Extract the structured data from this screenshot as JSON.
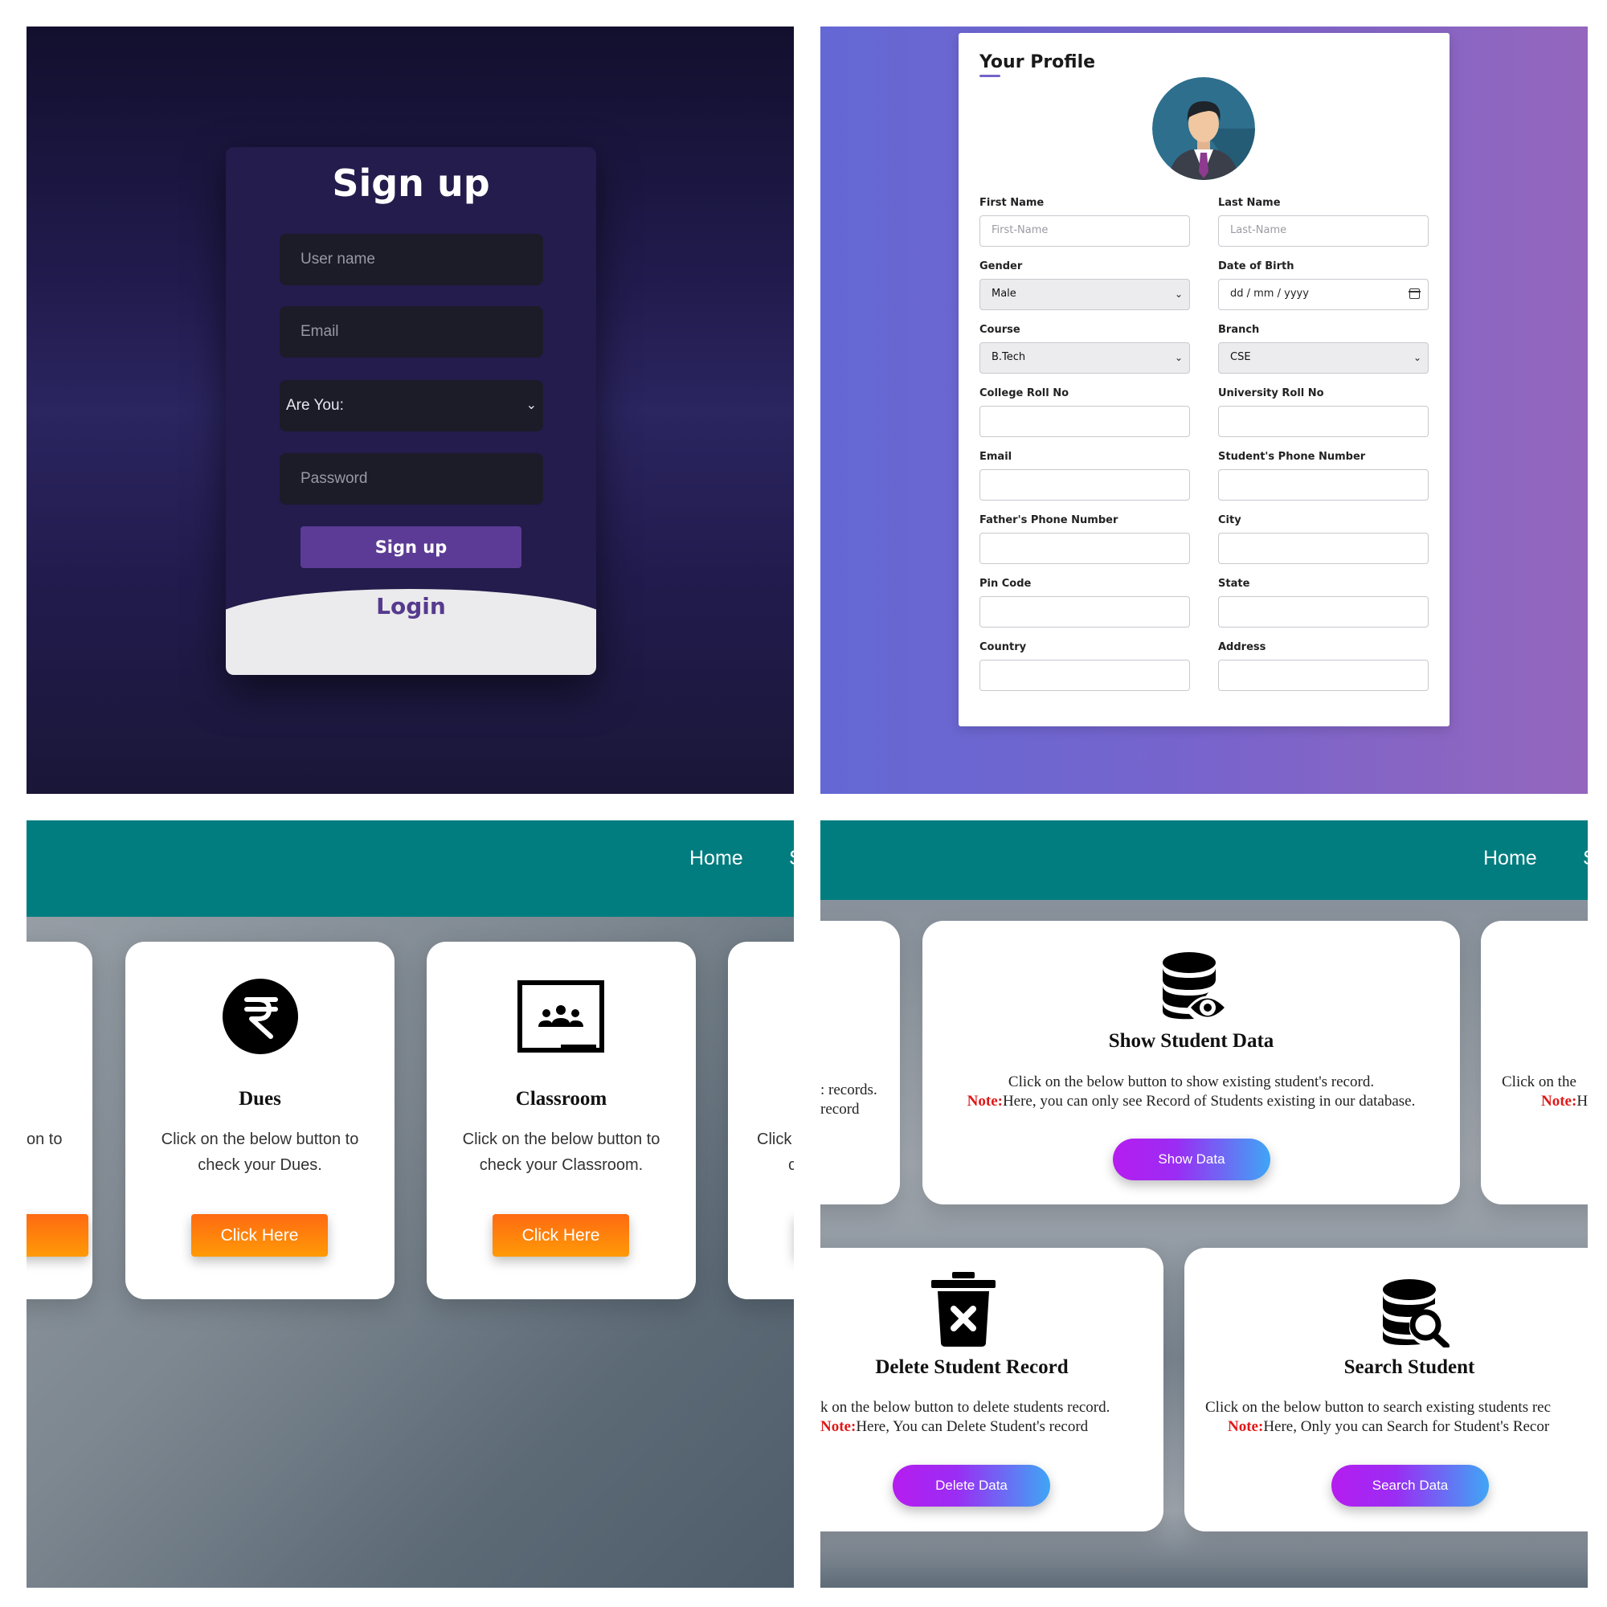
{
  "signup": {
    "title": "Sign up",
    "username_placeholder": "User name",
    "email_placeholder": "Email",
    "role_select": "Are You:",
    "password_placeholder": "Password",
    "submit_label": "Sign up",
    "login_label": "Login"
  },
  "profile": {
    "title": "Your Profile",
    "fields": {
      "first_name": {
        "label": "First Name",
        "placeholder": "First-Name"
      },
      "last_name": {
        "label": "Last Name",
        "placeholder": "Last-Name"
      },
      "gender": {
        "label": "Gender",
        "value": "Male"
      },
      "dob": {
        "label": "Date of Birth",
        "value": "dd / mm / yyyy"
      },
      "course": {
        "label": "Course",
        "value": "B.Tech"
      },
      "branch": {
        "label": "Branch",
        "value": "CSE"
      },
      "college_roll": {
        "label": "College Roll No"
      },
      "university_roll": {
        "label": "University Roll No"
      },
      "email": {
        "label": "Email"
      },
      "student_phone": {
        "label": "Student's Phone Number"
      },
      "father_phone": {
        "label": "Father's Phone Number"
      },
      "city": {
        "label": "City"
      },
      "pin_code": {
        "label": "Pin Code"
      },
      "state": {
        "label": "State"
      },
      "country": {
        "label": "Country"
      },
      "address": {
        "label": "Address"
      }
    }
  },
  "dashboard": {
    "nav_home": "Home",
    "nav_partial": "S",
    "partial_left_text": "on to",
    "partial_right_line1": "Click",
    "partial_right_line2": "c",
    "dues": {
      "title": "Dues",
      "desc_line1": "Click on the below button to",
      "desc_line2": "check your Dues.",
      "button": "Click Here"
    },
    "classroom": {
      "title": "Classroom",
      "desc_line1": "Click on the below button to",
      "desc_line2": "check your Classroom.",
      "button": "Click Here"
    }
  },
  "records": {
    "nav_home": "Home",
    "nav_partial": "S",
    "note_label": "Note:",
    "partial_left_line1": ": records.",
    "partial_left_line2": "record",
    "partial_right_line1": "Click on the",
    "partial_right_note": "Note:",
    "partial_right_rest": "H",
    "show": {
      "title": "Show Student Data",
      "line1": "Click on the below button to show existing student's record.",
      "note_text": "Here, you can only see Record of Students existing in our database.",
      "button": "Show Data"
    },
    "delete": {
      "title": "Delete Student Record",
      "line1": "k on the below button to delete students record.",
      "note_text": "Here, You can Delete Student's record",
      "button": "Delete Data"
    },
    "search": {
      "title": "Search Student",
      "line1": "Click on the below button to search existing students rec",
      "note_text": "Here, Only you can Search for Student's Recor",
      "button": "Search Data"
    }
  },
  "colors": {
    "signup_button": "#5c3b96",
    "teal_nav": "#017d80",
    "orange_button": "#ff7a0c",
    "note_red": "#e01818"
  }
}
